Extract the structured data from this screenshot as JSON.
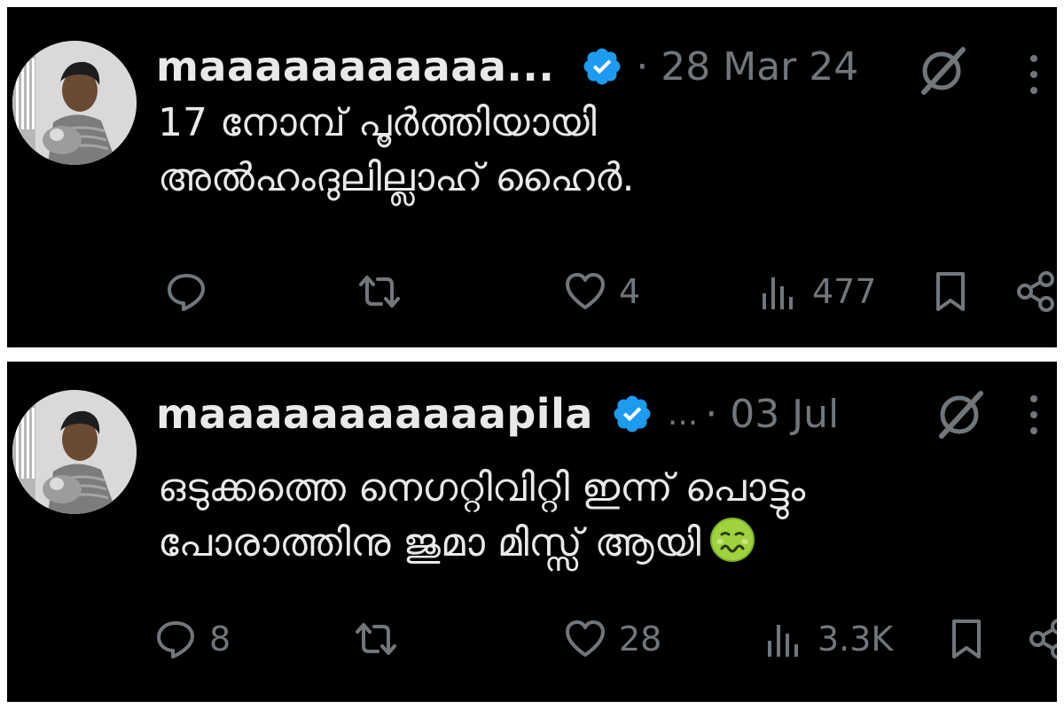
{
  "colors": {
    "background": "#000000",
    "text": "#e7e9ea",
    "secondary": "#71767b",
    "verified": "#1d9bf0",
    "separator": "#ffffff"
  },
  "tweets": [
    {
      "username": "maaaaaaaaaaa...",
      "show_ellipsis": false,
      "date": "· 28 Mar 24",
      "lines": [
        "17 നോമ്പ് പൂർത്തിയായി",
        "അൽഹംദുലില്ലാഹ് ഹൈർ."
      ],
      "emoji": "",
      "reply_count": "",
      "retweet_count": "",
      "like_count": "4",
      "views_count": "477",
      "icons": [
        "avatar",
        "verified-badge-icon",
        "grok-icon",
        "more-icon",
        "reply-icon",
        "retweet-icon",
        "like-icon",
        "views-icon",
        "bookmark-icon",
        "share-icon"
      ]
    },
    {
      "username": "maaaaaaaaaaapila",
      "show_ellipsis": true,
      "ellipsis": "...",
      "date": "· 03 Jul",
      "lines": [
        "ഒടുക്കത്തെ നെഗറ്റിവിറ്റി ഇന്ന് പൊട്ടും",
        "പോരാത്തിനു ജുമാ മിസ്സ് ആയി"
      ],
      "emoji": "nauseated-face-emoji",
      "reply_count": "8",
      "retweet_count": "",
      "like_count": "28",
      "views_count": "3.3K",
      "icons": [
        "avatar",
        "verified-badge-icon",
        "grok-icon",
        "more-icon",
        "reply-icon",
        "retweet-icon",
        "like-icon",
        "views-icon",
        "bookmark-icon",
        "share-icon"
      ]
    }
  ]
}
